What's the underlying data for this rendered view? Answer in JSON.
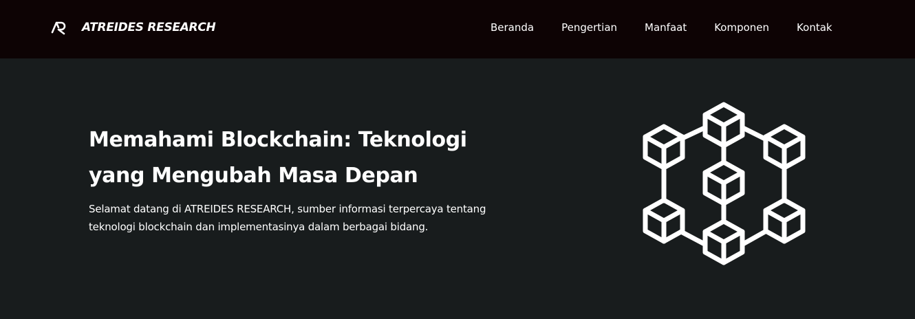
{
  "brand": {
    "name": "ATREIDES RESEARCH",
    "logo_icon": "atreides-logo-icon"
  },
  "nav": {
    "items": [
      {
        "label": "Beranda"
      },
      {
        "label": "Pengertian"
      },
      {
        "label": "Manfaat"
      },
      {
        "label": "Komponen"
      },
      {
        "label": "Kontak"
      }
    ]
  },
  "hero": {
    "title": "Memahami Blockchain: Teknologi yang Mengubah Masa Depan",
    "description": "Selamat datang di ATREIDES RESEARCH, sumber informasi terpercaya tentang teknologi blockchain dan implementasinya dalam berbagai bidang.",
    "graphic_icon": "blockchain-network-icon"
  },
  "colors": {
    "navbar_bg": "#0d0304",
    "hero_bg": "#181c1d",
    "text": "#ffffff"
  }
}
